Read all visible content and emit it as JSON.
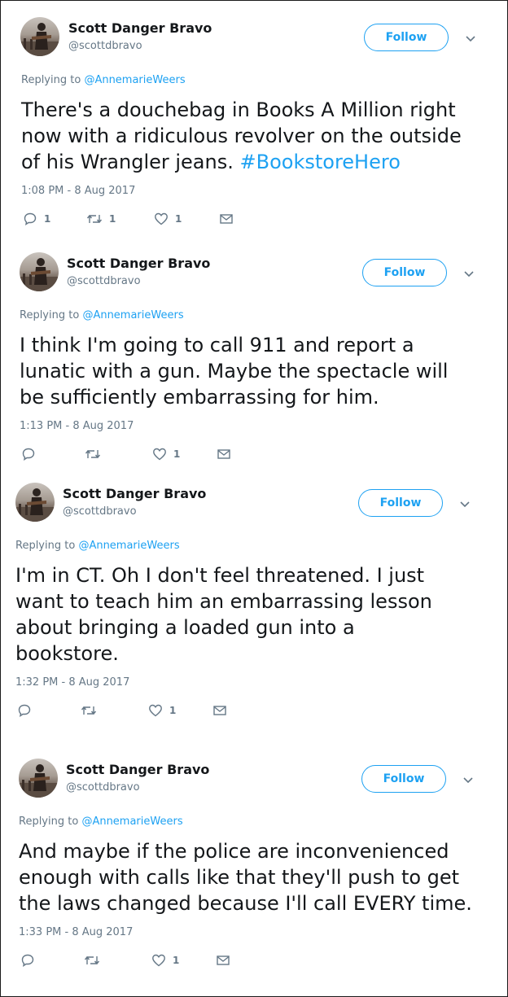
{
  "tweets": [
    {
      "name": "Scott Danger Bravo",
      "handle": "@scottdbravo",
      "follow_label": "Follow",
      "replying_prefix": "Replying to ",
      "replying_to": "@AnnemarieWeers",
      "lines": [
        "There's a douchebag in Books A Million right",
        "now with a ridiculous revolver on the outside",
        "of his Wrangler jeans. "
      ],
      "hashtag": "#BookstoreHero",
      "timestamp": "1:08 PM - 8 Aug 2017",
      "replies": "1",
      "retweets": "1",
      "likes": "1"
    },
    {
      "name": "Scott Danger Bravo",
      "handle": "@scottdbravo",
      "follow_label": "Follow",
      "replying_prefix": "Replying to ",
      "replying_to": "@AnnemarieWeers",
      "lines": [
        "I think I'm going to call 911 and report a",
        "lunatic with a gun. Maybe the spectacle will",
        "be sufficiently embarrassing for him."
      ],
      "timestamp": "1:13 PM - 8 Aug 2017",
      "replies": "",
      "retweets": "",
      "likes": "1"
    },
    {
      "name": "Scott Danger Bravo",
      "handle": "@scottdbravo",
      "follow_label": "Follow",
      "replying_prefix": "Replying to ",
      "replying_to": "@AnnemarieWeers",
      "lines": [
        "I'm in CT. Oh I don't feel threatened. I just",
        "want to teach him an embarrassing lesson",
        "about bringing a loaded gun into a",
        "bookstore."
      ],
      "timestamp": "1:32 PM - 8 Aug 2017",
      "replies": "",
      "retweets": "",
      "likes": "1"
    },
    {
      "name": "Scott Danger Bravo",
      "handle": "@scottdbravo",
      "follow_label": "Follow",
      "replying_prefix": "Replying to ",
      "replying_to": "@AnnemarieWeers",
      "lines": [
        "And maybe if the police are inconvenienced",
        "enough with calls like that they'll push to get",
        "the laws changed because I'll call EVERY time."
      ],
      "timestamp": "1:33 PM - 8 Aug 2017",
      "replies": "",
      "retweets": "",
      "likes": "1"
    }
  ],
  "icons": {
    "reply": "reply-icon",
    "retweet": "retweet-icon",
    "like": "heart-icon",
    "dm": "envelope-icon",
    "menu": "chevron-down-icon"
  },
  "colors": {
    "accent": "#1da1f2",
    "secondary_text": "#657786",
    "text": "#14171a"
  }
}
